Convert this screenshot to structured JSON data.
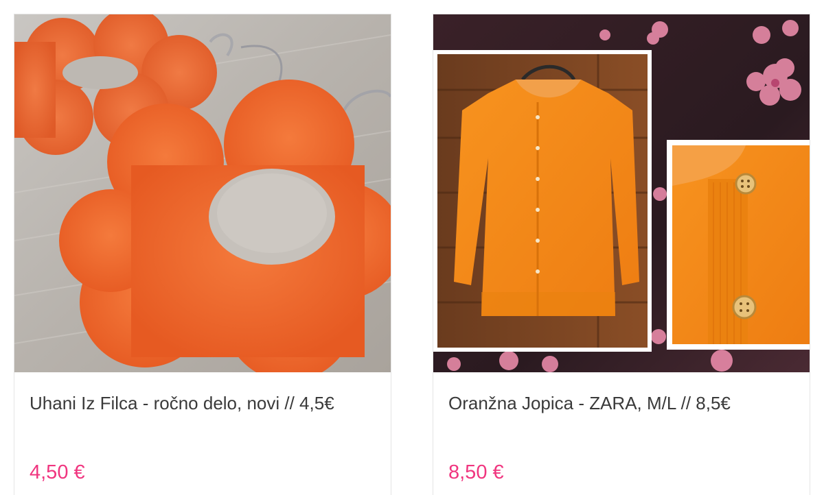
{
  "products": [
    {
      "title": "Uhani Iz Filca - ročno delo, novi // 4,5€",
      "price": "4,50 €",
      "image_icon": "felt-flower-earrings-photo"
    },
    {
      "title": "Oranžna Jopica - ZARA, M/L // 8,5€",
      "price": "8,50 €",
      "image_icon": "orange-cardigan-photo"
    }
  ],
  "colors": {
    "price": "#f0357f",
    "title": "#3a3a3a",
    "felt_orange": "#f26a2e",
    "cardigan_orange": "#f6891f"
  }
}
